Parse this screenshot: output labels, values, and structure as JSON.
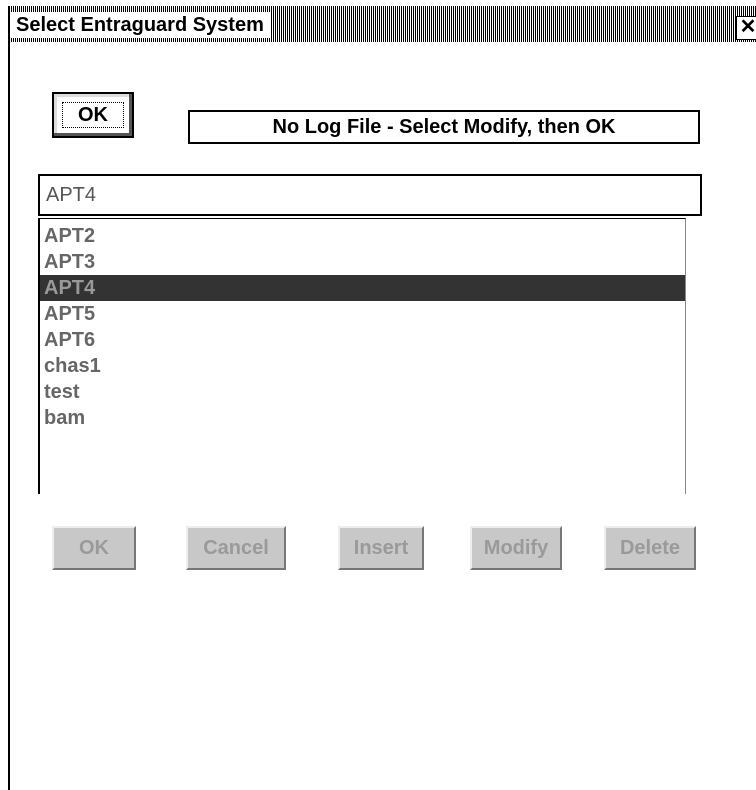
{
  "window": {
    "title": "Select Entraguard System",
    "close_glyph": "✕"
  },
  "top": {
    "ok_label": "OK",
    "status_message": "No Log File - Select Modify, then OK"
  },
  "combo": {
    "value": "APT4"
  },
  "list": {
    "items": [
      "APT2",
      "APT3",
      "APT4",
      "APT5",
      "APT6",
      "chas1",
      "test",
      "bam"
    ],
    "selected": "APT4"
  },
  "buttons": {
    "ok": "OK",
    "cancel": "Cancel",
    "insert": "Insert",
    "modify": "Modify",
    "delete": "Delete"
  }
}
